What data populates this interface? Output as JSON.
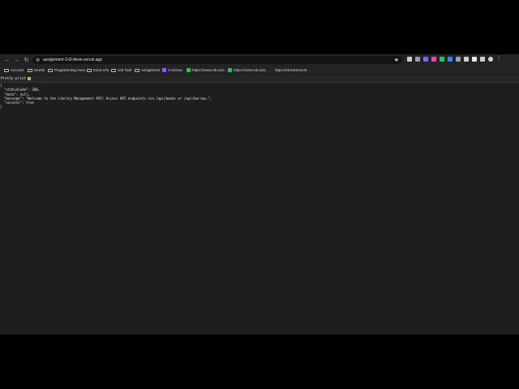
{
  "browser": {
    "url": "assignment-3-l2-three.vercel.app",
    "nav": {
      "back": "←",
      "forward": "→",
      "reload": "↻"
    }
  },
  "bookmarks": [
    {
      "label": "Account",
      "icon": "folder-icon"
    },
    {
      "label": "Needs",
      "icon": "folder-icon"
    },
    {
      "label": "Programming Hero",
      "icon": "folder-icon"
    },
    {
      "label": "Extra Info",
      "icon": "folder-icon"
    },
    {
      "label": "Job Task",
      "icon": "folder-icon"
    },
    {
      "label": "Assignment",
      "icon": "folder-icon"
    },
    {
      "label": "Continue",
      "icon": "favicon-purple"
    },
    {
      "label": "https://www.educati...",
      "icon": "favicon-green"
    },
    {
      "label": "https://www.educati...",
      "icon": "favicon-green"
    },
    {
      "label": "https://ebooksresult...",
      "icon": "none"
    }
  ],
  "prettyprint": {
    "label": "Pretty-print",
    "checked": true
  },
  "json_lines": [
    "{",
    "  \"statusCode\": 200,",
    "  \"data\": null,",
    "  \"message\": \"Welcome to the Library Management API! Access API endpoints via /api/books or /api/borrow.\",",
    "  \"success\": true",
    "}"
  ],
  "colors": {
    "page_bg": "#1e1e1e",
    "toolbar_bg": "#232325",
    "letterbox": "#000000"
  }
}
